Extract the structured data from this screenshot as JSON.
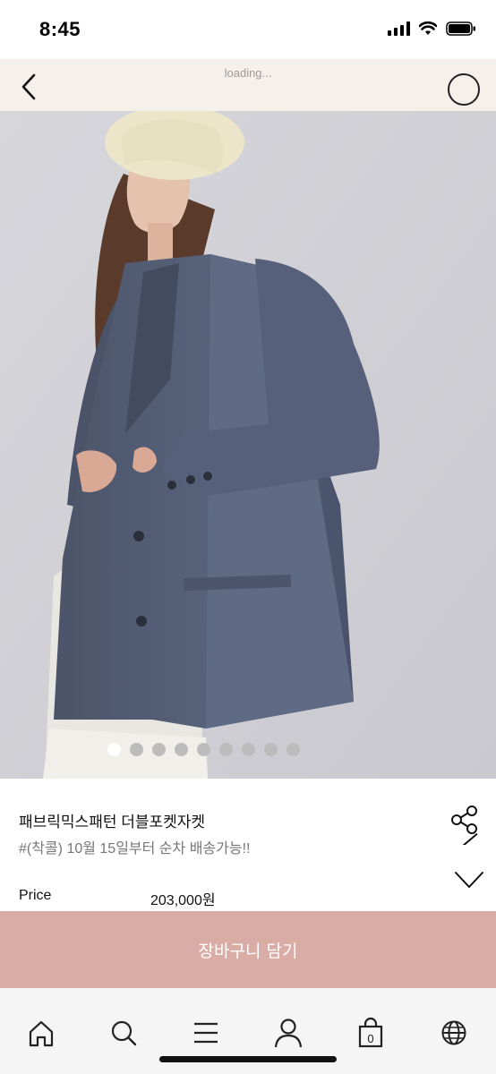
{
  "status_bar": {
    "time": "8:45"
  },
  "nav": {
    "loading_text": "loading..."
  },
  "gallery": {
    "total_images": 9,
    "current_index": 1
  },
  "product": {
    "name": "패브릭믹스패턴 더블포켓자켓",
    "subtitle": "#(착콜) 10월 15일부터 순차 배송가능!!",
    "price_label": "Price",
    "price_value": "203,000원"
  },
  "cart_button": {
    "label": "장바구니 담기"
  },
  "tab_bar": {
    "items": [
      "home-icon",
      "search-icon",
      "menu-icon",
      "user-icon",
      "shopping-bag-icon",
      "globe-icon"
    ],
    "bag_count": "0"
  },
  "colors": {
    "accent": "#d9aca6",
    "nav_bg": "#f6f0ea",
    "tab_bg": "#f5f5f5"
  }
}
